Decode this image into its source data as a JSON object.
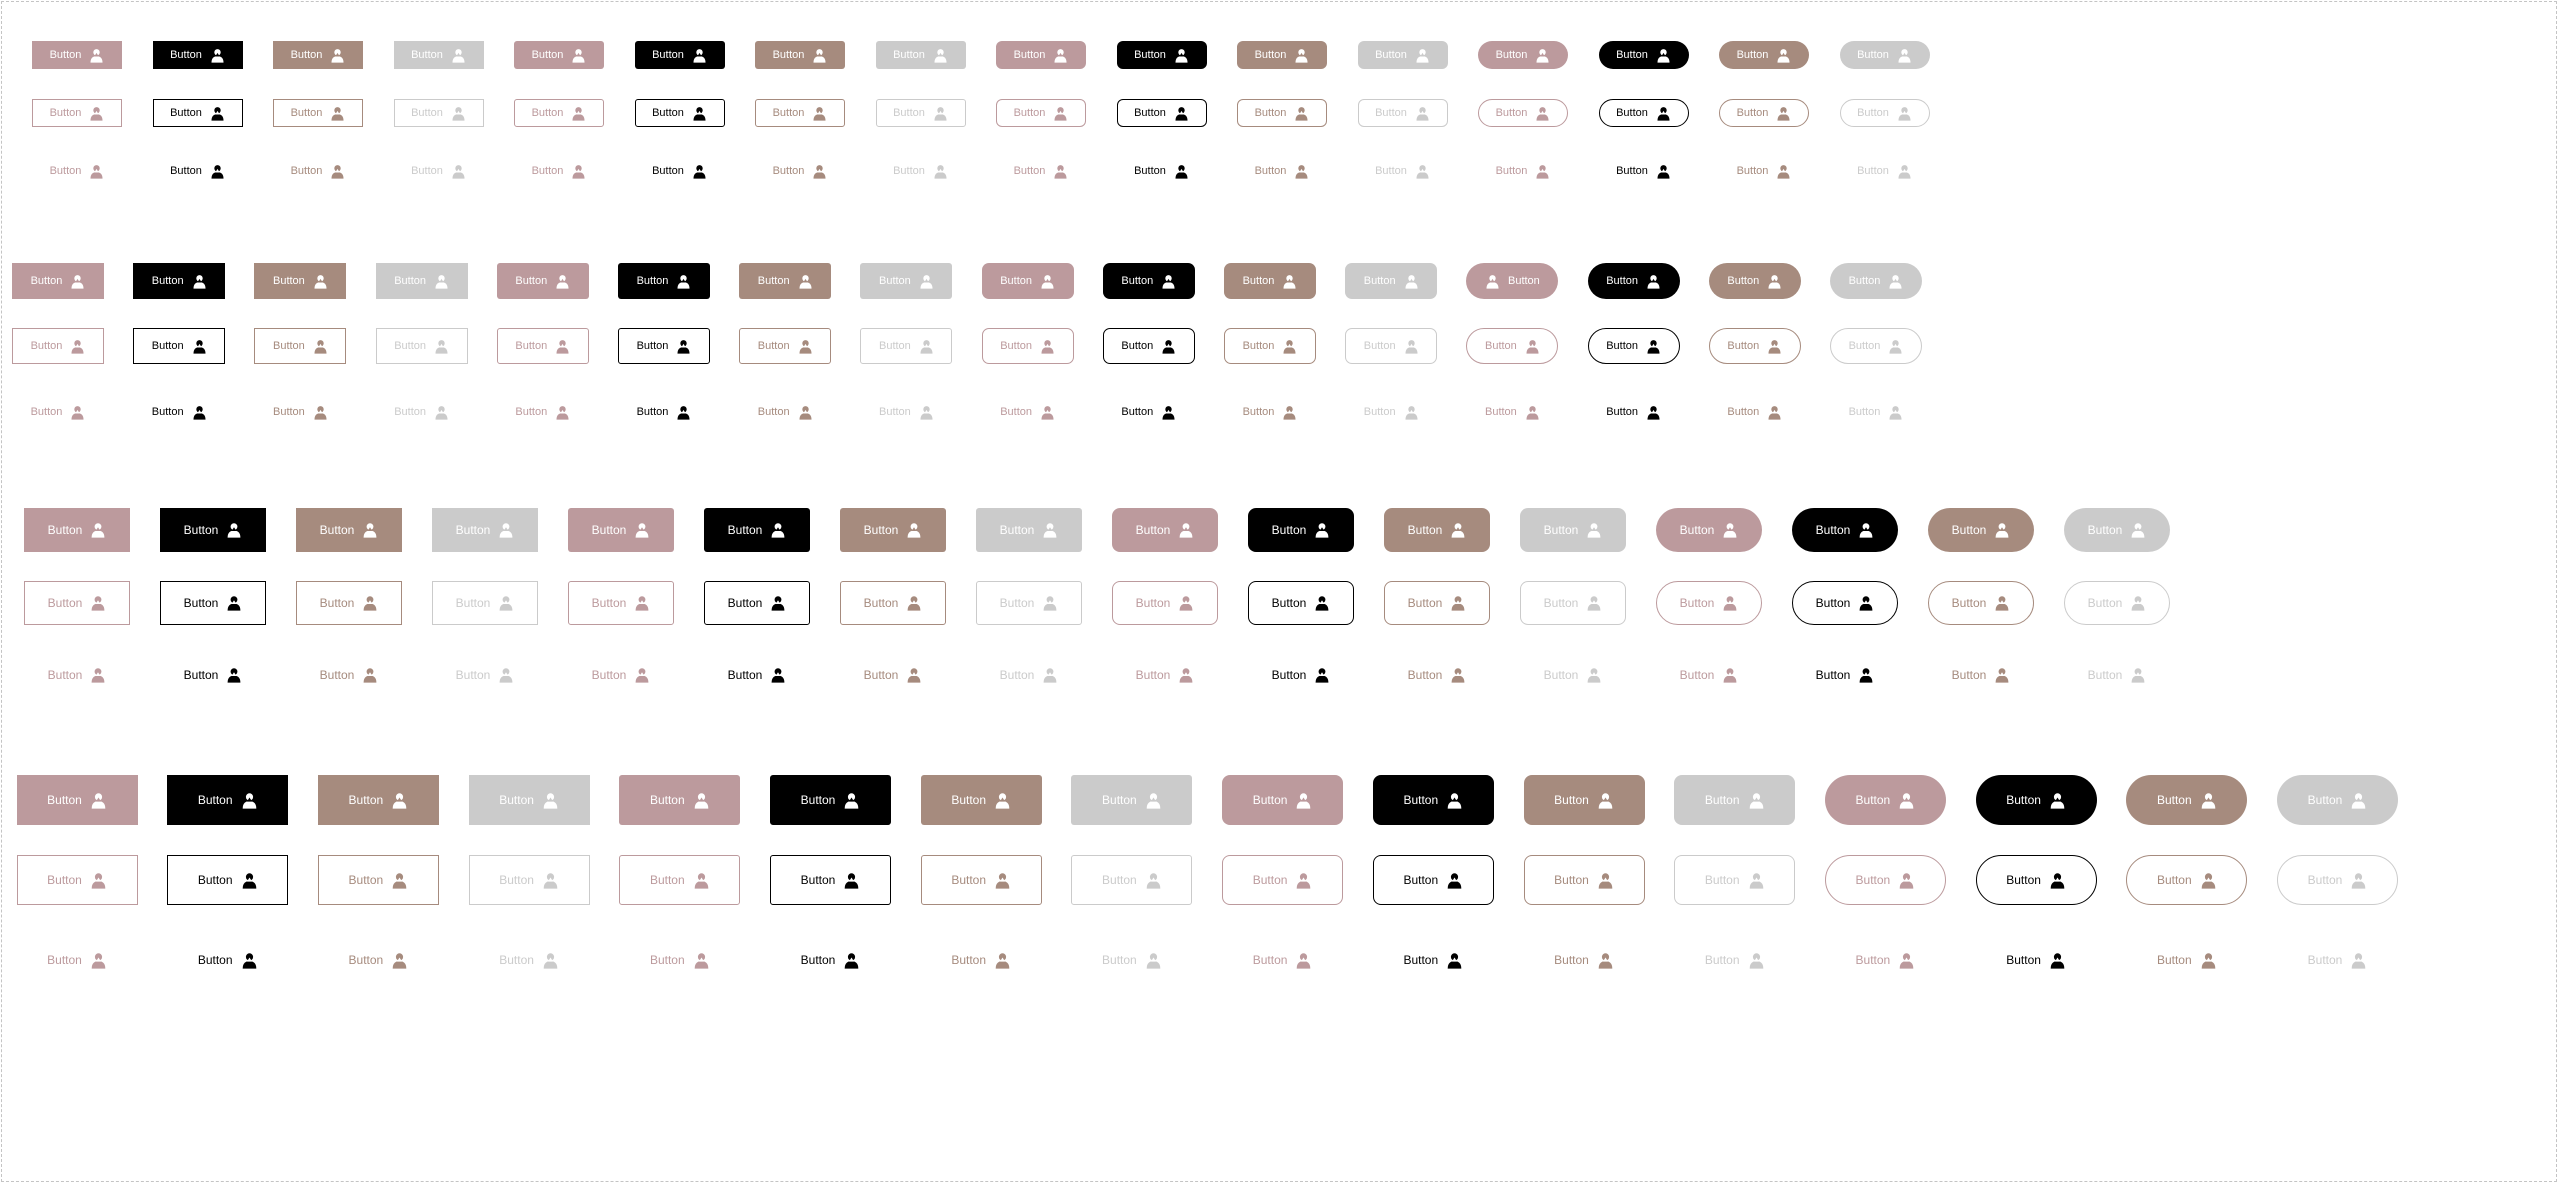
{
  "button_label": "Button",
  "icon_name": "person-icon",
  "colors": {
    "rose": "#bc9a9d",
    "black": "#000000",
    "taupe": "#a68b7e",
    "gray": "#cbcbcb",
    "white": "#ffffff",
    "border_dashed": "#c4c4c4"
  },
  "variants": [
    "filled",
    "outlined",
    "text"
  ],
  "color_order": [
    "rose",
    "black",
    "taupe",
    "gray",
    "rose",
    "black",
    "taupe",
    "gray",
    "rose",
    "black",
    "taupe",
    "gray",
    "rose",
    "black",
    "taupe",
    "gray"
  ],
  "shape_order": [
    "square",
    "square",
    "square",
    "square",
    "slightly-rounded",
    "slightly-rounded",
    "slightly-rounded",
    "slightly-rounded",
    "rounded",
    "rounded",
    "rounded",
    "rounded",
    "pill",
    "pill",
    "pill",
    "pill"
  ],
  "size_groups": [
    "small",
    "medium",
    "large",
    "x-large"
  ],
  "icon_first_exceptions": [
    {
      "group": "medium",
      "variant": "filled",
      "column": 12
    }
  ]
}
